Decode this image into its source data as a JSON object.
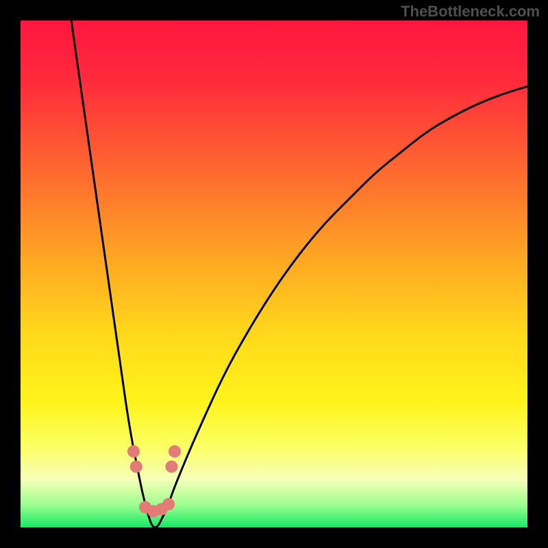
{
  "watermark": "TheBottleneck.com",
  "chart_data": {
    "type": "line",
    "title": "",
    "xlabel": "",
    "ylabel": "",
    "xlim": [
      0,
      100
    ],
    "ylim": [
      0,
      100
    ],
    "background_gradient": {
      "stops": [
        {
          "offset": 0.0,
          "color": "#ff163f"
        },
        {
          "offset": 0.12,
          "color": "#ff2b3b"
        },
        {
          "offset": 0.3,
          "color": "#ff6a2f"
        },
        {
          "offset": 0.48,
          "color": "#ffaa22"
        },
        {
          "offset": 0.62,
          "color": "#ffd91a"
        },
        {
          "offset": 0.75,
          "color": "#fff31a"
        },
        {
          "offset": 0.84,
          "color": "#fcff63"
        },
        {
          "offset": 0.905,
          "color": "#f6ffb8"
        },
        {
          "offset": 0.955,
          "color": "#9dff8f"
        },
        {
          "offset": 1.0,
          "color": "#17e866"
        }
      ]
    },
    "series": [
      {
        "name": "bottleneck-curve",
        "comment": "V-shaped bottleneck curve; y≈100 is top (red), y≈0 is bottom (green). Minimum sits near x≈26 at the very bottom.",
        "x": [
          10,
          12,
          14,
          16,
          18,
          20,
          21,
          22,
          23,
          24,
          25,
          26,
          27,
          28,
          29,
          30,
          32,
          35,
          40,
          45,
          50,
          55,
          60,
          65,
          70,
          75,
          80,
          85,
          90,
          95,
          100
        ],
        "y": [
          100,
          86,
          72,
          58,
          44,
          30,
          23,
          17,
          12,
          7,
          3,
          0,
          0,
          2,
          4,
          7,
          12,
          19,
          30,
          39,
          47,
          54,
          60,
          65,
          70,
          74,
          78,
          81,
          83.5,
          85.5,
          87
        ]
      }
    ],
    "markers": [
      {
        "name": "left-marker-upper",
        "x": 22.3,
        "y": 15.0,
        "color": "#e37c77"
      },
      {
        "name": "left-marker-lower",
        "x": 22.8,
        "y": 12.0,
        "color": "#e37c77"
      },
      {
        "name": "right-marker-upper",
        "x": 30.4,
        "y": 15.0,
        "color": "#e37c77"
      },
      {
        "name": "right-marker-lower",
        "x": 29.8,
        "y": 12.0,
        "color": "#e37c77"
      },
      {
        "name": "bottom-cluster-a",
        "x": 24.6,
        "y": 4.0,
        "color": "#e37c77"
      },
      {
        "name": "bottom-cluster-b",
        "x": 26.2,
        "y": 3.2,
        "color": "#e37c77"
      },
      {
        "name": "bottom-cluster-c",
        "x": 27.8,
        "y": 3.6,
        "color": "#e37c77"
      },
      {
        "name": "bottom-cluster-d",
        "x": 29.2,
        "y": 4.6,
        "color": "#e37c77"
      }
    ]
  }
}
